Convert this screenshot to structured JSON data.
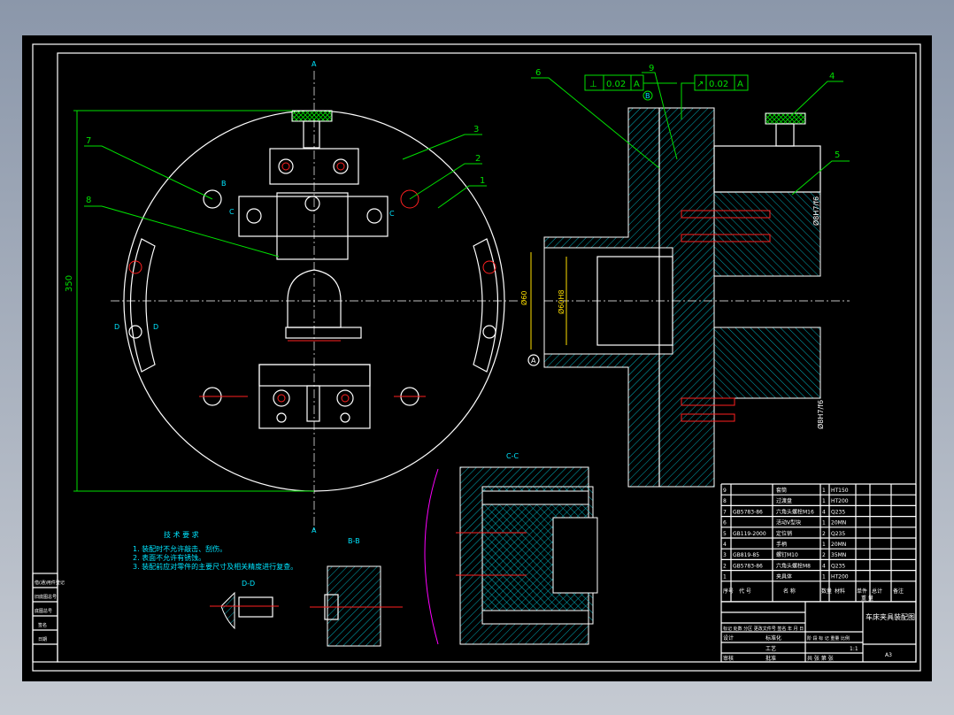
{
  "drawing": {
    "title": "车床夹具装配图",
    "scale": "1:1",
    "sheet_code": "A3"
  },
  "callouts": [
    "1",
    "2",
    "3",
    "4",
    "5",
    "6",
    "7",
    "8",
    "9"
  ],
  "views": {
    "section_a": "A",
    "section_b": "B-B",
    "section_c": "C-C",
    "section_d": "D-D",
    "mark_b": "B",
    "mark_d": "D",
    "mark_c": "C"
  },
  "dimensions": {
    "overall": "350",
    "fit_pin": "Ø8H7/f6",
    "fit_bore": "Ø60H8",
    "fit_shaft": "Ø60",
    "datum": "A"
  },
  "tolerances": [
    {
      "symbol": "⊥",
      "value": "0.02",
      "datum": "A"
    },
    {
      "symbol": "↗",
      "value": "0.02",
      "datum": "A"
    }
  ],
  "tech_requirements": {
    "title": "技 术 要 求",
    "items": [
      "1. 装配时不允许敲击、刮伤。",
      "2. 表面不允许有锈蚀。",
      "3. 装配前应对零件的主要尺寸及相关精度进行复查。"
    ]
  },
  "parts_list": {
    "rows": [
      {
        "no": "9",
        "code": "",
        "name": "套筒",
        "qty": "1",
        "material": "HT150"
      },
      {
        "no": "8",
        "code": "",
        "name": "过渡盘",
        "qty": "1",
        "material": "HT200"
      },
      {
        "no": "7",
        "code": "GB5783-86",
        "name": "六角头螺栓M16",
        "qty": "4",
        "material": "Q235"
      },
      {
        "no": "6",
        "code": "",
        "name": "活动V型块",
        "qty": "1",
        "material": "20MN"
      },
      {
        "no": "5",
        "code": "GB119-2000",
        "name": "定位销",
        "qty": "2",
        "material": "Q235"
      },
      {
        "no": "4",
        "code": "",
        "name": "手柄",
        "qty": "1",
        "material": "20MN"
      },
      {
        "no": "3",
        "code": "GB819-85",
        "name": "螺钉M10",
        "qty": "2",
        "material": "35MN"
      },
      {
        "no": "2",
        "code": "GB5783-86",
        "name": "六角头螺栓M8",
        "qty": "4",
        "material": "Q235"
      },
      {
        "no": "1",
        "code": "",
        "name": "夹具体",
        "qty": "1",
        "material": "HT200"
      }
    ],
    "header": {
      "no": "序号",
      "code": "代 号",
      "name": "名 称",
      "qty": "数量",
      "material": "材料",
      "unit": "单件",
      "total": "总计",
      "weight": "重 量",
      "remark": "备注"
    }
  },
  "title_block": {
    "revision_row": "标记 处数 分区 更改文件号 签名 年 月 日",
    "design": "设计",
    "standardize": "标准化",
    "check": "审核",
    "process": "工艺",
    "approve": "批准",
    "stage": "阶 段 标 记  重量  比例",
    "sheets": "共  张  第  张"
  },
  "side_stamps": [
    "借(通)用件登记",
    "旧底图总号",
    "底图总号",
    "签名",
    "日期"
  ]
}
